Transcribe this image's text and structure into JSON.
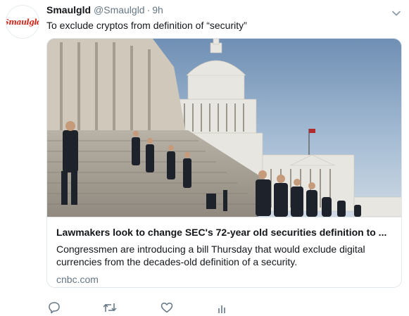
{
  "tweet": {
    "avatar_text": "Smaulgld",
    "name": "Smaulgld",
    "handle": "@Smaulgld",
    "separator": "·",
    "time": "9h",
    "text": "To exclude cryptos from definition of “security”"
  },
  "card": {
    "title": "Lawmakers look to change SEC's 72-year old securities definition to ...",
    "description": "Congressmen are introducing a bill Thursday that would exclude digital currencies from the decades-old definition of a security.",
    "domain": "cnbc.com"
  },
  "actions": {
    "icons": [
      "reply-icon",
      "retweet-icon",
      "like-icon",
      "analytics-icon"
    ]
  },
  "colors": {
    "secondary_text": "#657786",
    "border": "#e1e8ed",
    "avatar_red": "#d4281c"
  }
}
